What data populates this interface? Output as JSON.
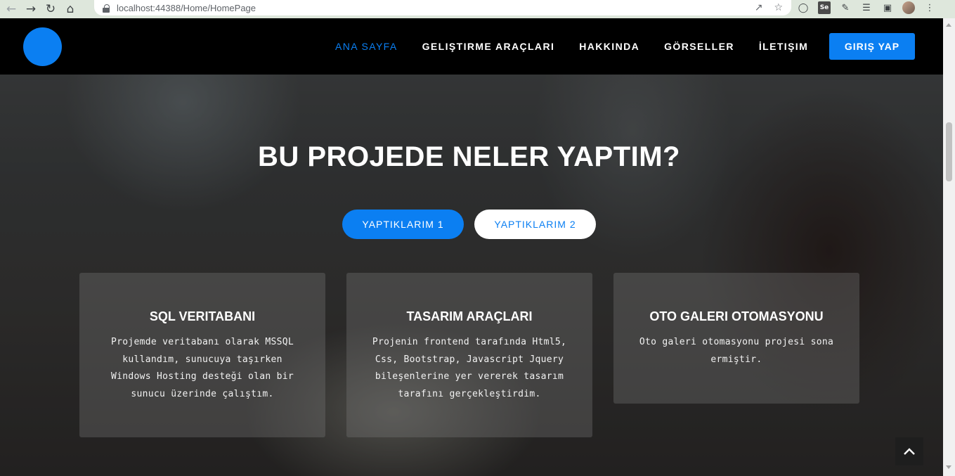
{
  "browser": {
    "url": "localhost:44388/Home/HomePage",
    "back_icon": "arrow-left-icon",
    "forward_icon": "arrow-right-icon",
    "reload_icon": "reload-icon",
    "home_icon": "home-icon"
  },
  "nav": {
    "items": [
      {
        "label": "ANA SAYFA",
        "active": true
      },
      {
        "label": "GELIŞTIRME ARAÇLARI",
        "active": false
      },
      {
        "label": "HAKKINDA",
        "active": false
      },
      {
        "label": "GÖRSELLER",
        "active": false
      },
      {
        "label": "İLETIŞIM",
        "active": false
      }
    ],
    "login_label": "GIRIŞ YAP"
  },
  "hero": {
    "title": "BU PROJEDE NELER YAPTIM?",
    "tab1_label": "YAPTIKLARIM 1",
    "tab2_label": "YAPTIKLARIM 2"
  },
  "cards": [
    {
      "title": "SQL VERITABANI",
      "text": "Projemde veritabanı olarak MSSQL kullandım, sunucuya taşırken Windows Hosting desteği olan bir sunucu üzerinde çalıştım."
    },
    {
      "title": "TASARIM ARAÇLARI",
      "text": "Projenin frontend tarafında Html5, Css, Bootstrap, Javascript Jquery bileşenlerine yer vererek tasarım tarafını gerçekleştirdim."
    },
    {
      "title": "OTO GALERI OTOMASYONU",
      "text": "Oto galeri otomasyonu projesi sona ermiştir."
    }
  ],
  "colors": {
    "accent": "#0b7ff2",
    "navbar": "#000000"
  }
}
